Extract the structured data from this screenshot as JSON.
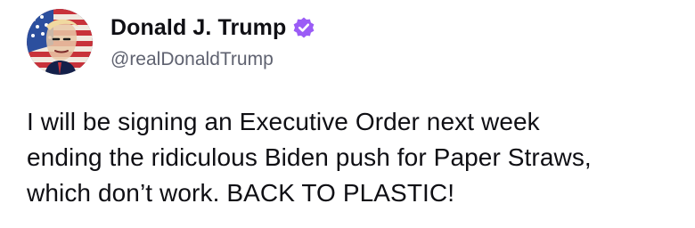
{
  "author": {
    "display_name": "Donald J. Trump",
    "handle": "@realDonaldTrump",
    "verified": true,
    "verified_badge_color": "#9b5cf6",
    "avatar_icon": "avatar-flag-portrait"
  },
  "post": {
    "text": "I will be signing an Executive Order next week\nending the ridiculous Biden push for Paper Straws,\nwhich don’t work. BACK TO PLASTIC!"
  },
  "colors": {
    "text_primary": "#0f0f14",
    "text_secondary": "#5f6270",
    "background": "#ffffff"
  }
}
